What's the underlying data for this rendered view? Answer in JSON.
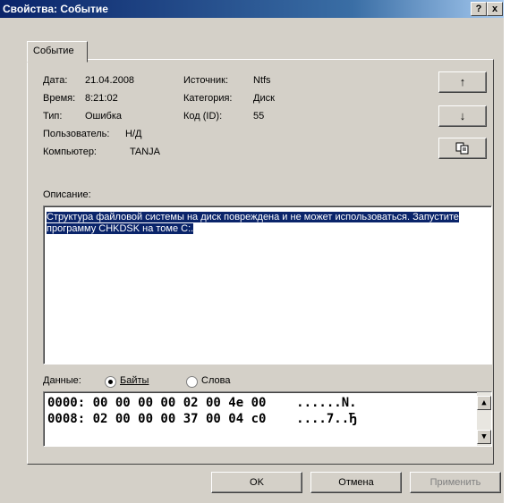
{
  "window": {
    "title": "Свойства: Событие",
    "help_label": "?",
    "close_label": "x"
  },
  "tabs": [
    {
      "label": "Событие"
    }
  ],
  "event": {
    "date_label": "Дата:",
    "date_value": "21.04.2008",
    "source_label": "Источник:",
    "source_value": "Ntfs",
    "time_label": "Время:",
    "time_value": "8:21:02",
    "category_label": "Категория:",
    "category_value": "Диск",
    "type_label": "Тип:",
    "type_value": "Ошибка",
    "code_label": "Код (ID):",
    "code_value": "55",
    "user_label": "Пользователь:",
    "user_value": "Н/Д",
    "computer_label": "Компьютер:",
    "computer_value": "TANJA"
  },
  "nav": {
    "up_icon": "arrow-up-icon",
    "up_label": "↑",
    "down_icon": "arrow-down-icon",
    "down_label": "↓",
    "copy_icon": "copy-icon"
  },
  "description": {
    "label": "Описание:",
    "text": "Структура файловой системы на диск повреждена и не может использоваться. Запустите программу CHKDSK на томе C:."
  },
  "data": {
    "label": "Данные:",
    "bytes_label": "Байты",
    "words_label": "Слова",
    "selected": "bytes",
    "lines": [
      "0000: 00 00 00 00 02 00 4e 00    ......N.",
      "0008: 02 00 00 00 37 00 04 c0    ....7..Ђ"
    ]
  },
  "buttons": {
    "ok": "OK",
    "cancel": "Отмена",
    "apply": "Применить"
  },
  "colors": {
    "titlebar": "#0a246a",
    "selection": "#0a246a",
    "face": "#d4d0c8"
  }
}
